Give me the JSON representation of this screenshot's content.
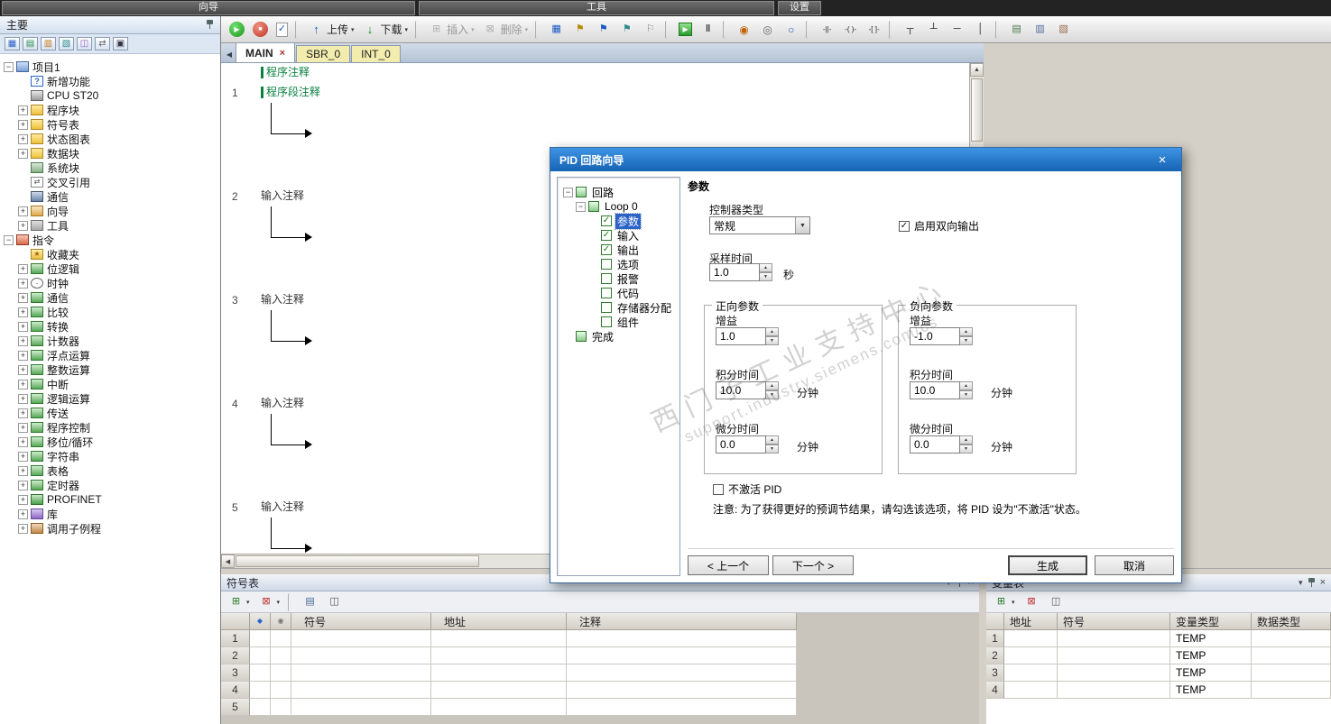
{
  "window": {
    "toolbar_titles": [
      "向导",
      "工具",
      "设置"
    ]
  },
  "main_toolbar": {
    "items": [
      {
        "name": "run-button",
        "icon": "run"
      },
      {
        "name": "stop-button",
        "icon": "stop"
      },
      {
        "name": "compile-button",
        "icon": "compile"
      },
      {
        "name": "separator",
        "icon": "sep",
        "it": "false"
      },
      {
        "name": "upload-button",
        "icon": "upload",
        "label": "上传",
        "dd": "1"
      },
      {
        "name": "download-button",
        "icon": "download",
        "label": "下载",
        "dd": "1"
      },
      {
        "name": "separator",
        "icon": "sep",
        "it": "false"
      },
      {
        "name": "insert-button",
        "icon": "insert",
        "label": "插入",
        "dd": "1",
        "disabled": "1"
      },
      {
        "name": "delete-button",
        "icon": "delete",
        "label": "删除",
        "dd": "1",
        "disabled": "1"
      },
      {
        "name": "separator",
        "icon": "sep",
        "it": "false"
      },
      {
        "name": "toggle-addressing-button",
        "icon": "addressing"
      },
      {
        "name": "bookmark-button",
        "icon": "bookmark"
      },
      {
        "name": "next-bookmark-button",
        "icon": "next-bookmark"
      },
      {
        "name": "previous-bookmark-button",
        "icon": "prev-bookmark"
      },
      {
        "name": "clear-bookmarks-button",
        "icon": "clear-bookmarks"
      },
      {
        "name": "separator",
        "icon": "sep",
        "it": "false"
      },
      {
        "name": "program-status-button",
        "icon": "program-status"
      },
      {
        "name": "pause-status-button",
        "icon": "pause-status"
      },
      {
        "name": "separator",
        "icon": "sep",
        "it": "false"
      },
      {
        "name": "force-button",
        "icon": "force"
      },
      {
        "name": "unforce-button",
        "icon": "unforce"
      },
      {
        "name": "read-forced-button",
        "icon": "read-forced"
      },
      {
        "name": "separator",
        "icon": "sep",
        "it": "false"
      },
      {
        "name": "insert-contact-button",
        "icon": "contact"
      },
      {
        "name": "insert-coil-button",
        "icon": "coil"
      },
      {
        "name": "insert-box-button",
        "icon": "box"
      },
      {
        "name": "separator",
        "icon": "sep",
        "it": "false"
      },
      {
        "name": "insert-branch-down-button",
        "icon": "branch-down"
      },
      {
        "name": "insert-branch-up-button",
        "icon": "branch-up"
      },
      {
        "name": "insert-horizontal-line-button",
        "icon": "line-h"
      },
      {
        "name": "insert-vertical-line-button",
        "icon": "line-v"
      },
      {
        "name": "separator",
        "icon": "sep",
        "it": "false"
      },
      {
        "name": "symbol-info-table-button",
        "icon": "symbol-info"
      },
      {
        "name": "toggle-comments-button",
        "icon": "comments"
      },
      {
        "name": "properties-button",
        "icon": "properties"
      }
    ]
  },
  "sidebar": {
    "title": "主要",
    "nav": [
      {
        "name": "nav-program-editor-icon",
        "icon": "nav1"
      },
      {
        "name": "nav-symbol-table-icon",
        "icon": "nav2"
      },
      {
        "name": "nav-status-chart-icon",
        "icon": "nav3"
      },
      {
        "name": "nav-data-block-icon",
        "icon": "nav4"
      },
      {
        "name": "nav-system-block-icon",
        "icon": "nav5"
      },
      {
        "name": "nav-cross-reference-icon",
        "icon": "nav6"
      },
      {
        "name": "nav-communications-icon",
        "icon": "nav7"
      }
    ],
    "tree": [
      {
        "label": "项目1",
        "level": 0,
        "exp": "minus",
        "icon": "project"
      },
      {
        "label": "新增功能",
        "level": 1,
        "exp": "none",
        "icon": "help"
      },
      {
        "label": "CPU ST20",
        "level": 1,
        "exp": "none",
        "icon": "cpu"
      },
      {
        "label": "程序块",
        "level": 1,
        "exp": "plus",
        "icon": "folder"
      },
      {
        "label": "符号表",
        "level": 1,
        "exp": "plus",
        "icon": "folder"
      },
      {
        "label": "状态图表",
        "level": 1,
        "exp": "plus",
        "icon": "folder"
      },
      {
        "label": "数据块",
        "level": 1,
        "exp": "plus",
        "icon": "folder"
      },
      {
        "label": "系统块",
        "level": 1,
        "exp": "none",
        "icon": "sysblock"
      },
      {
        "label": "交叉引用",
        "level": 1,
        "exp": "none",
        "icon": "crossref"
      },
      {
        "label": "通信",
        "level": 1,
        "exp": "none",
        "icon": "comm"
      },
      {
        "label": "向导",
        "level": 1,
        "exp": "plus",
        "icon": "wizard"
      },
      {
        "label": "工具",
        "level": 1,
        "exp": "plus",
        "icon": "tools"
      },
      {
        "label": "指令",
        "level": 0,
        "exp": "minus",
        "icon": "instructions"
      },
      {
        "label": "收藏夹",
        "level": 1,
        "exp": "none",
        "icon": "favorites"
      },
      {
        "label": "位逻辑",
        "level": 1,
        "exp": "plus",
        "icon": "category"
      },
      {
        "label": "时钟",
        "level": 1,
        "exp": "plus",
        "icon": "clock"
      },
      {
        "label": "通信",
        "level": 1,
        "exp": "plus",
        "icon": "category"
      },
      {
        "label": "比较",
        "level": 1,
        "exp": "plus",
        "icon": "category"
      },
      {
        "label": "转换",
        "level": 1,
        "exp": "plus",
        "icon": "category"
      },
      {
        "label": "计数器",
        "level": 1,
        "exp": "plus",
        "icon": "category"
      },
      {
        "label": "浮点运算",
        "level": 1,
        "exp": "plus",
        "icon": "category"
      },
      {
        "label": "整数运算",
        "level": 1,
        "exp": "plus",
        "icon": "category"
      },
      {
        "label": "中断",
        "level": 1,
        "exp": "plus",
        "icon": "category"
      },
      {
        "label": "逻辑运算",
        "level": 1,
        "exp": "plus",
        "icon": "category"
      },
      {
        "label": "传送",
        "level": 1,
        "exp": "plus",
        "icon": "category"
      },
      {
        "label": "程序控制",
        "level": 1,
        "exp": "plus",
        "icon": "category"
      },
      {
        "label": "移位/循环",
        "level": 1,
        "exp": "plus",
        "icon": "category"
      },
      {
        "label": "字符串",
        "level": 1,
        "exp": "plus",
        "icon": "category"
      },
      {
        "label": "表格",
        "level": 1,
        "exp": "plus",
        "icon": "category"
      },
      {
        "label": "定时器",
        "level": 1,
        "exp": "plus",
        "icon": "category"
      },
      {
        "label": "PROFINET",
        "level": 1,
        "exp": "plus",
        "icon": "profinet"
      },
      {
        "label": "库",
        "level": 1,
        "exp": "plus",
        "icon": "library"
      },
      {
        "label": "调用子例程",
        "level": 1,
        "exp": "plus",
        "icon": "subroutine"
      }
    ]
  },
  "editor": {
    "tabs": [
      {
        "name": "tab-main",
        "label": "MAIN",
        "active": true,
        "close": "×"
      },
      {
        "name": "tab-sbr0",
        "label": "SBR_0",
        "active": false
      },
      {
        "name": "tab-int0",
        "label": "INT_0",
        "active": false
      }
    ],
    "program_comment": "程序注释",
    "networks": [
      {
        "num": "1",
        "comment": "程序段注释",
        "ctype": "section"
      },
      {
        "num": "2",
        "comment": "输入注释",
        "ctype": "input"
      },
      {
        "num": "3",
        "comment": "输入注释",
        "ctype": "input"
      },
      {
        "num": "4",
        "comment": "输入注释",
        "ctype": "input"
      },
      {
        "num": "5",
        "comment": "输入注释",
        "ctype": "input"
      }
    ]
  },
  "dialog": {
    "title": "PID 回路向导",
    "tree": [
      {
        "label": "回路",
        "level": 0,
        "exp": "minus",
        "box": "node"
      },
      {
        "label": "Loop 0",
        "level": 1,
        "exp": "minus",
        "box": "node"
      },
      {
        "label": "参数",
        "level": 2,
        "exp": "none",
        "box": "checked",
        "sel": "1"
      },
      {
        "label": "输入",
        "level": 2,
        "exp": "none",
        "box": "checked"
      },
      {
        "label": "输出",
        "level": 2,
        "exp": "none",
        "box": "checked"
      },
      {
        "label": "选项",
        "level": 2,
        "exp": "none",
        "box": "unchecked"
      },
      {
        "label": "报警",
        "level": 2,
        "exp": "none",
        "box": "unchecked"
      },
      {
        "label": "代码",
        "level": 2,
        "exp": "none",
        "box": "unchecked"
      },
      {
        "label": "存储器分配",
        "level": 2,
        "exp": "none",
        "box": "unchecked"
      },
      {
        "label": "组件",
        "level": 2,
        "exp": "none",
        "box": "unchecked"
      },
      {
        "label": "完成",
        "level": 0,
        "exp": "none",
        "box": "node"
      }
    ],
    "heading": "参数",
    "controller_type_label": "控制器类型",
    "controller_type_value": "常规",
    "bidirectional_output_label": "启用双向输出",
    "bidirectional_output_checked": true,
    "sample_time_label": "采样时间",
    "sample_time_value": "1.0",
    "sample_time_unit": "秒",
    "forward": {
      "title": "正向参数",
      "gain_label": "增益",
      "gain_value": "1.0",
      "integral_label": "积分时间",
      "integral_value": "10.0",
      "integral_unit": "分钟",
      "derivative_label": "微分时间",
      "derivative_value": "0.0",
      "derivative_unit": "分钟"
    },
    "reverse": {
      "title": "负向参数",
      "gain_label": "增益",
      "gain_value": "-1.0",
      "integral_label": "积分时间",
      "integral_value": "10.0",
      "integral_unit": "分钟",
      "derivative_label": "微分时间",
      "derivative_value": "0.0",
      "derivative_unit": "分钟"
    },
    "deactivate_label": "不激活 PID",
    "deactivate_checked": false,
    "note": "注意: 为了获得更好的预调节结果，请勾选该选项，将 PID 设为\"不激活\"状态。",
    "buttons": {
      "prev": "< 上一个",
      "next": "下一个 >",
      "generate": "生成",
      "cancel": "取消"
    },
    "watermark": {
      "line1": "西门子工业支持中心",
      "line2": "support.industry.siemens.com/cs"
    }
  },
  "symbol_table": {
    "title": "符号表",
    "columns": {
      "symbol": "符号",
      "address": "地址",
      "comment": "注释"
    },
    "toolbar": [
      {
        "name": "insert-row-button",
        "icon": "insert-row",
        "dd": "1"
      },
      {
        "name": "delete-row-button",
        "icon": "delete-row",
        "dd": "1"
      },
      {
        "name": "separator",
        "icon": "sep",
        "it": "false"
      },
      {
        "name": "symbol-info-button",
        "icon": "symbol-info2"
      },
      {
        "name": "filter-button",
        "icon": "filter"
      }
    ],
    "rows": [
      {
        "num": "1"
      },
      {
        "num": "2"
      },
      {
        "num": "3"
      },
      {
        "num": "4"
      },
      {
        "num": "5"
      }
    ]
  },
  "variable_table": {
    "title": "变量表",
    "columns": {
      "address": "地址",
      "symbol": "符号",
      "var_type": "变量类型",
      "data_type": "数据类型"
    },
    "toolbar": [
      {
        "name": "insert-row-button",
        "icon": "insert-row",
        "dd": "1"
      },
      {
        "name": "delete-row-button",
        "icon": "delete-row"
      },
      {
        "name": "filter-button",
        "icon": "filter"
      }
    ],
    "rows": [
      {
        "num": "1",
        "var_type": "TEMP"
      },
      {
        "num": "2",
        "var_type": "TEMP"
      },
      {
        "num": "3",
        "var_type": "TEMP"
      },
      {
        "num": "4",
        "var_type": "TEMP"
      }
    ]
  }
}
